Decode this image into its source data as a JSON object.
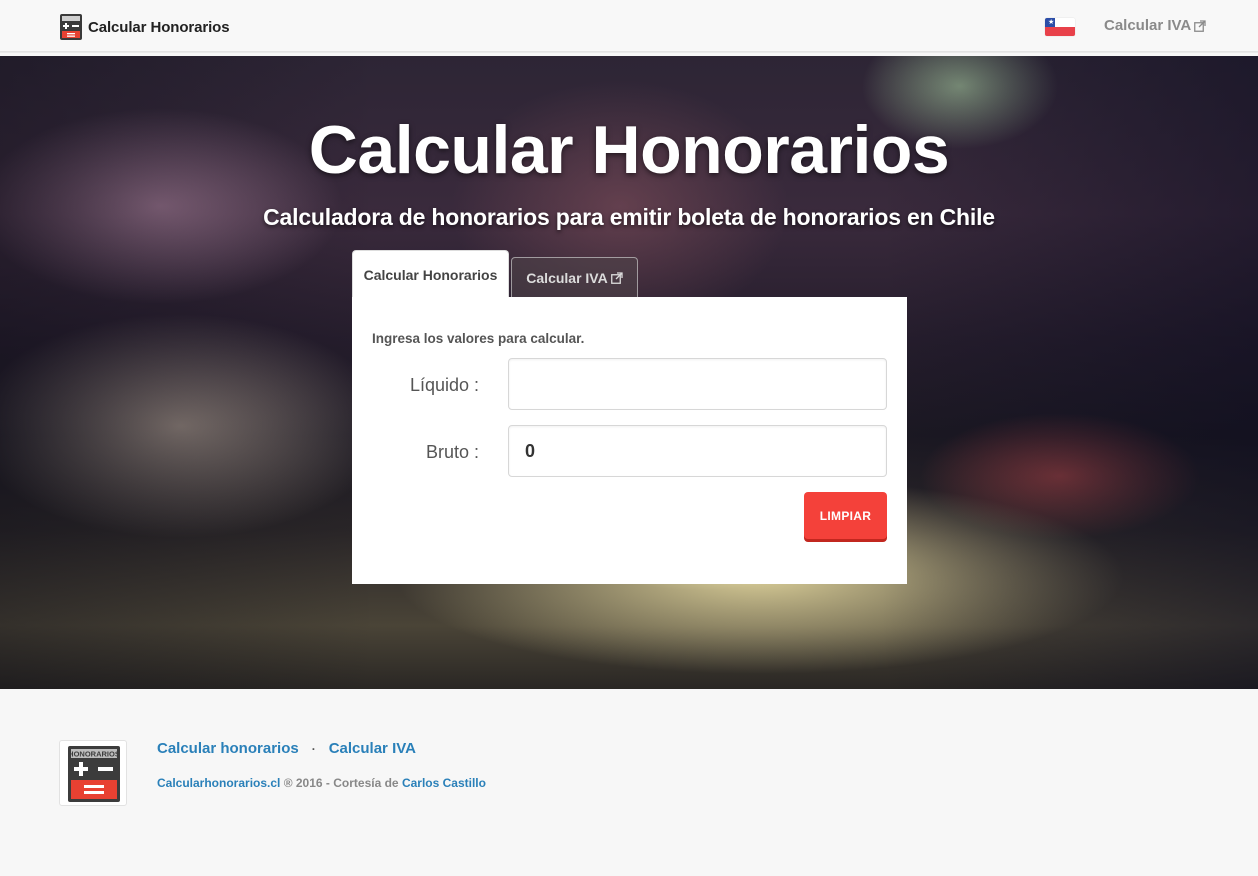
{
  "navbar": {
    "brand": "Calcular Honorarios",
    "link_iva": "Calcular IVA"
  },
  "hero": {
    "title": "Calcular Honorarios",
    "subtitle": "Calculadora de honorarios para emitir boleta de honorarios en Chile"
  },
  "tabs": [
    {
      "label": "Calcular Honorarios",
      "active": true
    },
    {
      "label": "Calcular IVA",
      "active": false
    }
  ],
  "form": {
    "intro": "Ingresa los valores para calcular.",
    "liquido_label": "Líquido :",
    "liquido_value": "",
    "bruto_label": "Bruto :",
    "bruto_value": "0",
    "clear_button": "LIMPIAR"
  },
  "footer": {
    "link_honorarios": "Calcular honorarios",
    "separator": "·",
    "link_iva": "Calcular IVA",
    "site": "Calcularhonorarios.cl",
    "copyright": " ® 2016 - Cortesía de ",
    "author": "Carlos Castillo",
    "logo_text": "HONORARIOS"
  },
  "colors": {
    "accent_red": "#f4413a",
    "link_blue": "#2a80b9",
    "flag_red": "#e8414a",
    "flag_blue": "#2c4ea8"
  },
  "icons": [
    "calculator-logo-icon",
    "chile-flag-icon",
    "external-link-icon"
  ]
}
